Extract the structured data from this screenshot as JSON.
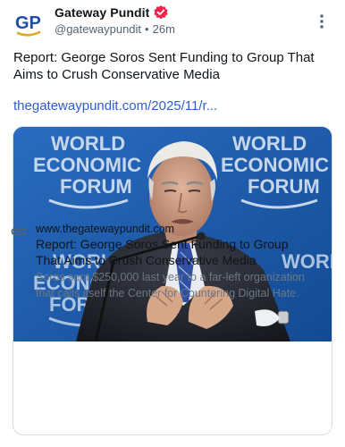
{
  "post": {
    "author": {
      "avatar_text": "GP",
      "display_name": "Gateway Pundit",
      "handle": "@gatewaypundit",
      "separator": "•",
      "time": "26m",
      "verified_icon": "verified-badge-icon",
      "verified_color": "#f4244e"
    },
    "text": "Report: George Soros Sent Funding to Group That Aims to Crush Conservative Media",
    "link": "thegatewaypundit.com/2025/11/r...",
    "more_icon": "more-vertical-icon"
  },
  "card": {
    "image_text_lines": [
      "WORLD",
      "ECONOMIC",
      "FORUM"
    ],
    "link_icon": "link-chain-icon",
    "domain": "www.thegatewaypundit.com",
    "title": "Report: George Soros Sent Funding to Group That Aims to Crush Conservative Media",
    "description": "Soros sent $250,000 last year to a far-left organization that calls itself the Center for Countering Digital Hate."
  },
  "colors": {
    "link": "#2f5dd0",
    "avatar_blue": "#1f4fa3",
    "avatar_gold": "#e0a81e",
    "image_background": "#1c5aa6"
  }
}
